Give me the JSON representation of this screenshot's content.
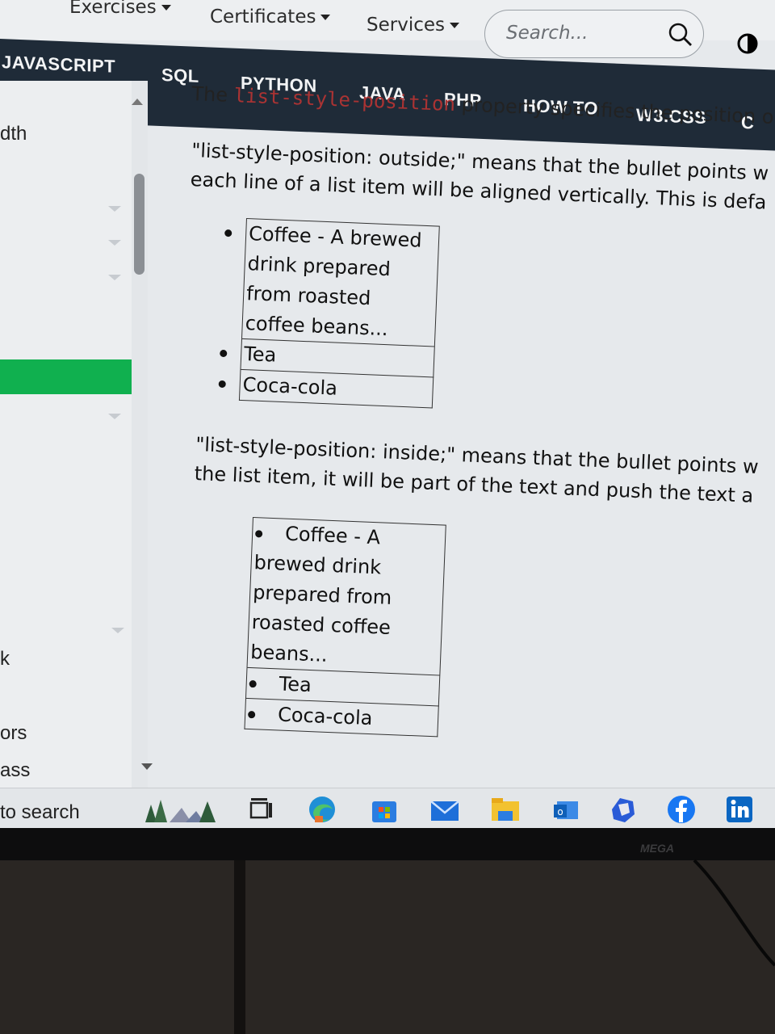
{
  "top_menu": {
    "exercises": "Exercises",
    "certificates": "Certificates",
    "services": "Services",
    "search_placeholder": "Search..."
  },
  "nav": [
    "JAVASCRIPT",
    "SQL",
    "PYTHON",
    "JAVA",
    "PHP",
    "HOW TO",
    "W3.CSS",
    "C"
  ],
  "sidebar": {
    "fragments": [
      "dth",
      "k",
      "ors",
      "ass"
    ]
  },
  "content": {
    "cut_line_prefix": "The",
    "cut_line_code": "list-style-position",
    "cut_line_suffix": "property specifies the position o",
    "outside_p1": "\"list-style-position: outside;\" means that the bullet points w",
    "outside_p2": "each line of a list item will be aligned vertically. This is defa",
    "outside_items": [
      "Coffee - A brewed drink prepared from roasted coffee beans...",
      "Tea",
      "Coca-cola"
    ],
    "inside_p1": "\"list-style-position: inside;\" means that the bullet points w",
    "inside_p2": "the list item, it will be part of the text and push the text a",
    "inside_items": [
      "Coffee - A brewed drink prepared from roasted coffee beans...",
      "Tea",
      "Coca-cola"
    ]
  },
  "taskbar": {
    "search_text": "to search"
  },
  "monitor_brand": "MEGA"
}
